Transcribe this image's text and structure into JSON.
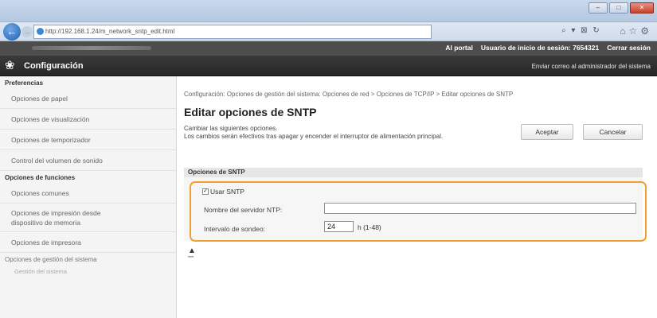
{
  "browser": {
    "address": "http://192.168.1.24/m_network_sntp_edit.html",
    "address_host": "192.168.1.24",
    "tools": "⌕ ▾ ⊠ ↻",
    "window_buttons": [
      "–",
      "□",
      "✕"
    ]
  },
  "header": {
    "portal_link": "Al portal",
    "login_user_label": "Usuario de inicio de sesión:",
    "login_user_value": "7654321",
    "logout_link": "Cerrar sesión",
    "app_title": "Configuración",
    "mail_admin": "Enviar correo al administrador del sistema"
  },
  "sidebar": {
    "heading_prefs": "Preferencias",
    "items_prefs": [
      "Opciones de papel",
      "Opciones de visualización",
      "Opciones de temporizador",
      "Control del volumen de sonido"
    ],
    "heading_funcs": "Opciones de funciones",
    "items_funcs": [
      "Opciones comunes",
      "Opciones de impresión desde",
      "dispositivo de memoria",
      "Opciones de impresora"
    ],
    "heading_mgmt": "Opciones de gestión del sistema",
    "sub_mgmt": "Gestión del sistema"
  },
  "main": {
    "breadcrumb": "Configuración: Opciones de gestión del sistema: Opciones de red > Opciones de TCP/IP > Editar opciones de SNTP",
    "title": "Editar opciones de SNTP",
    "desc_line1": "Cambiar las siguientes opciones.",
    "desc_line2": "Los cambios serán efectivos tras apagar y encender el interruptor de alimentación principal.",
    "accept_button": "Aceptar",
    "cancel_button": "Cancelar",
    "section_title": "Opciones de SNTP",
    "use_sntp_label": "Usar SNTP",
    "use_sntp_checked": true,
    "ntp_server_label": "Nombre del servidor NTP:",
    "ntp_server_value": "",
    "polling_label": "Intervalo de sondeo:",
    "polling_value": "24",
    "polling_range": "h (1-48)",
    "top_icon": "⏫"
  }
}
